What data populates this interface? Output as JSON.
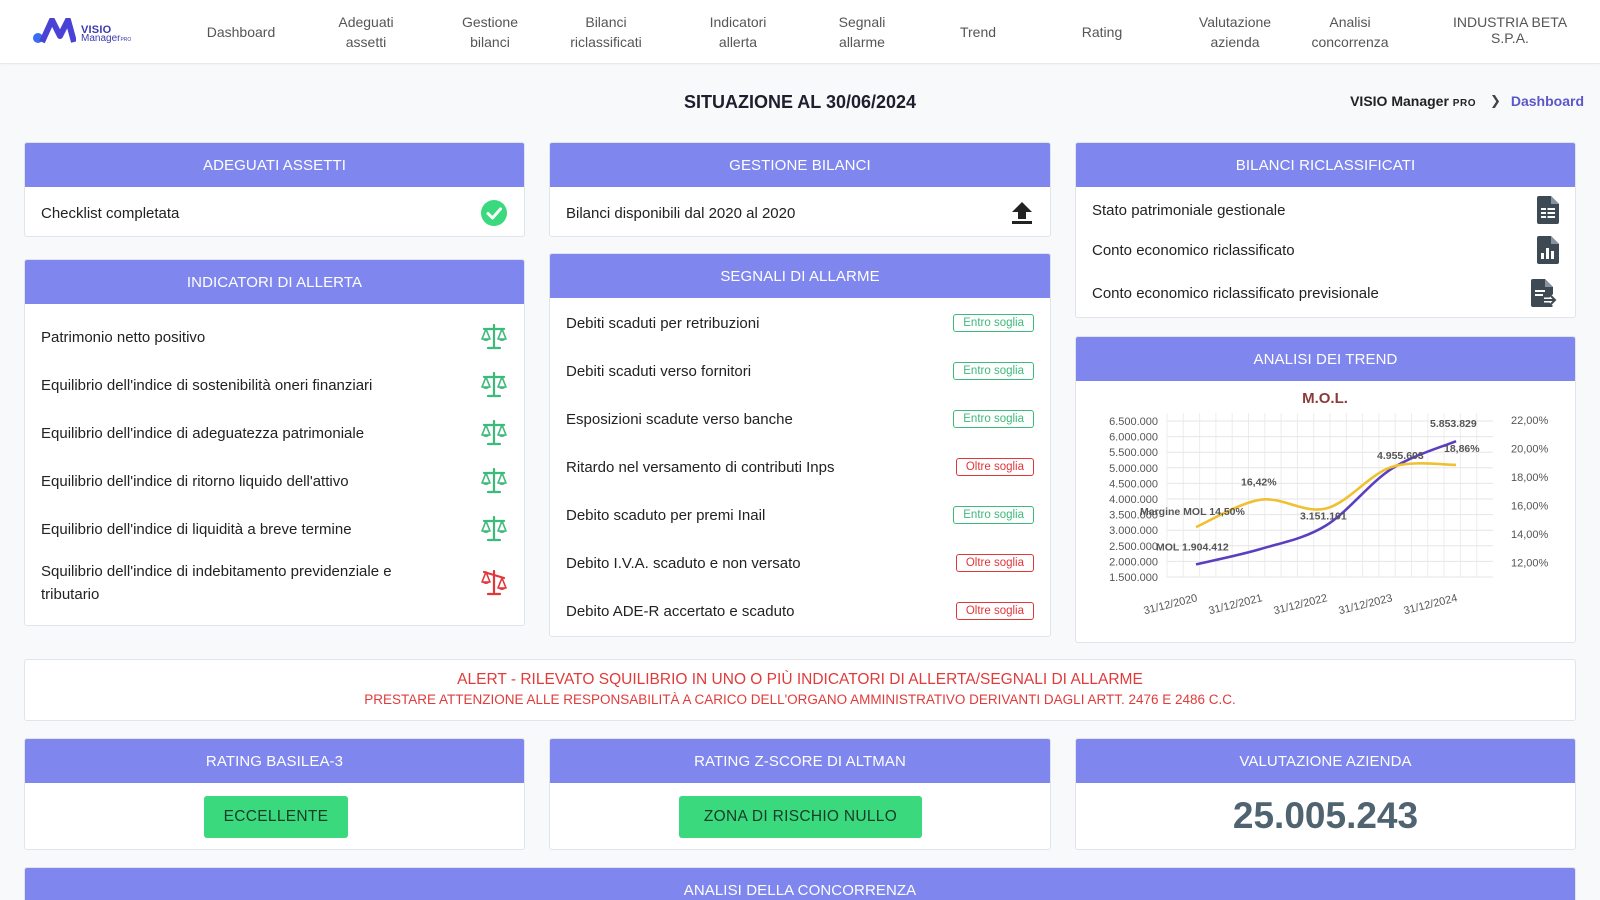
{
  "brand": {
    "line1": "VISIO",
    "line2": "Manager",
    "line2_sup": "PRO"
  },
  "nav": [
    {
      "label": "Dashboard"
    },
    {
      "label": "Adeguati\nassetti"
    },
    {
      "label": "Gestione\nbilanci"
    },
    {
      "label": "Bilanci\nriclassificati"
    },
    {
      "label": "Indicatori\nallerta"
    },
    {
      "label": "Segnali\nallarme"
    },
    {
      "label": "Trend"
    },
    {
      "label": "Rating"
    },
    {
      "label": "Valutazione\nazienda"
    },
    {
      "label": "Analisi\nconcorrenza"
    }
  ],
  "company": "INDUSTRIA BETA\nS.P.A.",
  "page_title": "SITUAZIONE AL 30/06/2024",
  "breadcrumb": {
    "root": "VISIO Manager",
    "root_sup": "PRO",
    "current": "Dashboard"
  },
  "adeguati": {
    "title": "ADEGUATI ASSETTI",
    "row": "Checklist completata"
  },
  "gestione": {
    "title": "GESTIONE BILANCI",
    "row": "Bilanci disponibili dal 2020 al 2020"
  },
  "riclassificati": {
    "title": "BILANCI RICLASSIFICATI",
    "rows": [
      "Stato patrimoniale gestionale",
      "Conto economico riclassificato",
      "Conto economico riclassificato previsionale"
    ]
  },
  "indicatori": {
    "title": "INDICATORI DI ALLERTA",
    "rows": [
      {
        "label": "Patrimonio netto positivo",
        "status": "ok"
      },
      {
        "label": "Equilibrio dell'indice di sostenibilità oneri finanziari",
        "status": "ok"
      },
      {
        "label": "Equilibrio dell'indice di adeguatezza patrimoniale",
        "status": "ok"
      },
      {
        "label": "Equilibrio dell'indice di ritorno liquido dell'attivo",
        "status": "ok"
      },
      {
        "label": "Equilibrio dell'indice di liquidità a breve termine",
        "status": "ok"
      },
      {
        "label": "Squilibrio dell'indice di indebitamento previdenziale e tributario",
        "status": "ko"
      }
    ]
  },
  "segnali": {
    "title": "SEGNALI DI ALLARME",
    "rows": [
      {
        "label": "Debiti scaduti per retribuzioni",
        "badge": "Entro soglia",
        "status": "ok"
      },
      {
        "label": "Debiti scaduti verso fornitori",
        "badge": "Entro soglia",
        "status": "ok"
      },
      {
        "label": "Esposizioni scadute verso banche",
        "badge": "Entro soglia",
        "status": "ok"
      },
      {
        "label": "Ritardo nel versamento di contributi Inps",
        "badge": "Oltre soglia",
        "status": "ko"
      },
      {
        "label": "Debito scaduto per premi Inail",
        "badge": "Entro soglia",
        "status": "ok"
      },
      {
        "label": "Debito I.V.A. scaduto e non versato",
        "badge": "Oltre soglia",
        "status": "ko"
      },
      {
        "label": "Debito ADE-R accertato e scaduto",
        "badge": "Oltre soglia",
        "status": "ko"
      }
    ]
  },
  "trend": {
    "title": "ANALISI DEI TREND",
    "chart_data": {
      "type": "line",
      "title": "M.O.L.",
      "x": [
        "31/12/2020",
        "31/12/2021",
        "31/12/2022",
        "31/12/2023",
        "31/12/2024"
      ],
      "y_left_ticks": [
        "6.500.000",
        "6.000.000",
        "5.500.000",
        "5.000.000",
        "4.500.000",
        "4.000.000",
        "3.500.000",
        "3.000.000",
        "2.500.000",
        "2.000.000",
        "1.500.000"
      ],
      "y_left_values": [
        6500000,
        6000000,
        5500000,
        5000000,
        4500000,
        4000000,
        3500000,
        3000000,
        2500000,
        2000000,
        1500000
      ],
      "y_right_ticks": [
        "22,00%",
        "20,00%",
        "18,00%",
        "16,00%",
        "14,00%",
        "12,00%"
      ],
      "y_right_values": [
        22,
        20,
        18,
        16,
        14,
        12
      ],
      "ylim_left": [
        1500000,
        6500000
      ],
      "ylim_right": [
        11,
        22.5
      ],
      "series": [
        {
          "name": "MOL",
          "axis": "left",
          "color": "#5a3fc0",
          "values": [
            1904412,
            2400000,
            3151101,
            4955603,
            5853829
          ],
          "labels": [
            "MOL 1.904.412",
            "",
            "3.151.101",
            "4.955.603",
            "5.853.829"
          ]
        },
        {
          "name": "Margine MOL",
          "axis": "right",
          "color": "#f0c030",
          "values": [
            14.5,
            16.42,
            15.8,
            18.7,
            18.86
          ],
          "labels": [
            "Margine MOL 14,50%",
            "16,42%",
            "",
            "",
            "18,86%"
          ]
        }
      ]
    }
  },
  "alert": {
    "line1": "ALERT - RILEVATO SQUILIBRIO IN UNO O PIÙ INDICATORI DI ALLERTA/SEGNALI DI ALLARME",
    "line2": "PRESTARE ATTENZIONE ALLE RESPONSABILITÀ A CARICO DELL'ORGANO AMMINISTRATIVO DERIVANTI DAGLI ARTT. 2476 E 2486 C.C."
  },
  "basilea": {
    "title": "RATING BASILEA-3",
    "value": "ECCELLENTE"
  },
  "altman": {
    "title": "RATING Z-SCORE DI ALTMAN",
    "value": "ZONA DI RISCHIO NULLO"
  },
  "valutazione": {
    "title": "VALUTAZIONE AZIENDA",
    "value": "25.005.243"
  },
  "concorrenza": {
    "title": "ANALISI DELLA CONCORRENZA"
  },
  "colors": {
    "header": "#7f86ee",
    "ok": "#3cba79",
    "ko": "#e0373a",
    "accent": "#5b56c9",
    "pill": "#3ad97e"
  },
  "icons": {
    "check": "check-circle-icon",
    "upload": "upload-icon",
    "balance_ok": "balance-scale-icon",
    "balance_ko": "balance-scale-unbalanced-icon"
  }
}
